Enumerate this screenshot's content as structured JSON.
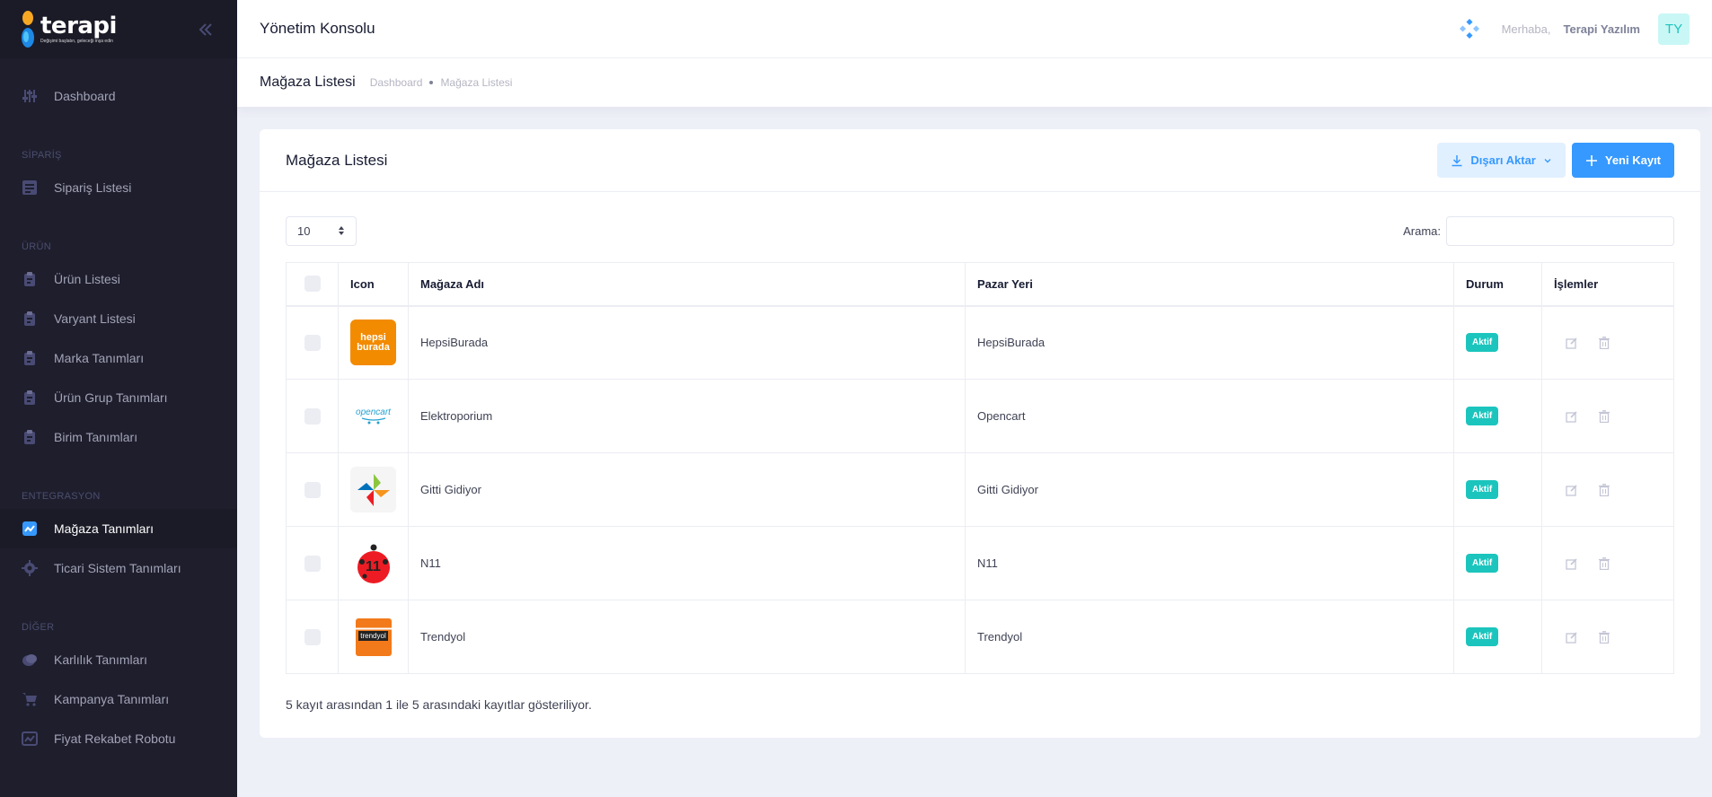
{
  "brand": {
    "name": "terapi",
    "tagline": "Değişimi başlatın, geleceği inşa edin"
  },
  "sidebar": {
    "items": [
      {
        "label": "Dashboard"
      }
    ],
    "sections": [
      {
        "title": "SİPARİŞ",
        "items": [
          {
            "label": "Sipariş Listesi"
          }
        ]
      },
      {
        "title": "ÜRÜN",
        "items": [
          {
            "label": "Ürün Listesi"
          },
          {
            "label": "Varyant Listesi"
          },
          {
            "label": "Marka Tanımları"
          },
          {
            "label": "Ürün Grup Tanımları"
          },
          {
            "label": "Birim Tanımları"
          }
        ]
      },
      {
        "title": "ENTEGRASYON",
        "items": [
          {
            "label": "Mağaza Tanımları"
          },
          {
            "label": "Ticari Sistem Tanımları"
          }
        ]
      },
      {
        "title": "DİĞER",
        "items": [
          {
            "label": "Karlılık Tanımları"
          },
          {
            "label": "Kampanya Tanımları"
          },
          {
            "label": "Fiyat Rekabet Robotu"
          }
        ]
      }
    ],
    "active_item": "Mağaza Tanımları"
  },
  "header": {
    "title": "Yönetim Konsolu",
    "greeting": "Merhaba,",
    "user_name": "Terapi Yazılım",
    "user_initials": "TY"
  },
  "subheader": {
    "title": "Mağaza Listesi",
    "breadcrumb": [
      "Dashboard",
      "Mağaza Listesi"
    ]
  },
  "card": {
    "title": "Mağaza Listesi",
    "export_label": "Dışarı Aktar",
    "new_label": "Yeni Kayıt",
    "page_size": "10",
    "search_label": "Arama:",
    "search_value": "",
    "columns": [
      "Icon",
      "Mağaza Adı",
      "Pazar Yeri",
      "Durum",
      "İşlemler"
    ],
    "rows": [
      {
        "icon": "hepsiburada-logo",
        "name": "HepsiBurada",
        "pazar": "HepsiBurada",
        "durum": "Aktif"
      },
      {
        "icon": "opencart-logo",
        "name": "Elektroporium",
        "pazar": "Opencart",
        "durum": "Aktif"
      },
      {
        "icon": "gittigidiyor-logo",
        "name": "Gitti Gidiyor",
        "pazar": "Gitti Gidiyor",
        "durum": "Aktif"
      },
      {
        "icon": "n11-logo",
        "name": "N11",
        "pazar": "N11",
        "durum": "Aktif"
      },
      {
        "icon": "trendyol-logo",
        "name": "Trendyol",
        "pazar": "Trendyol",
        "durum": "Aktif"
      }
    ],
    "logo_text": {
      "hepsiburada": "hepsi burada",
      "opencart": "opencart",
      "n11": "11",
      "trendyol": "trendyol"
    },
    "info": "5 kayıt arasından 1 ile 5 arasındaki kayıtlar gösteriliyor."
  },
  "colors": {
    "sidebar_bg": "#1e1e2d",
    "primary": "#3699ff",
    "success": "#1bc5bd"
  }
}
